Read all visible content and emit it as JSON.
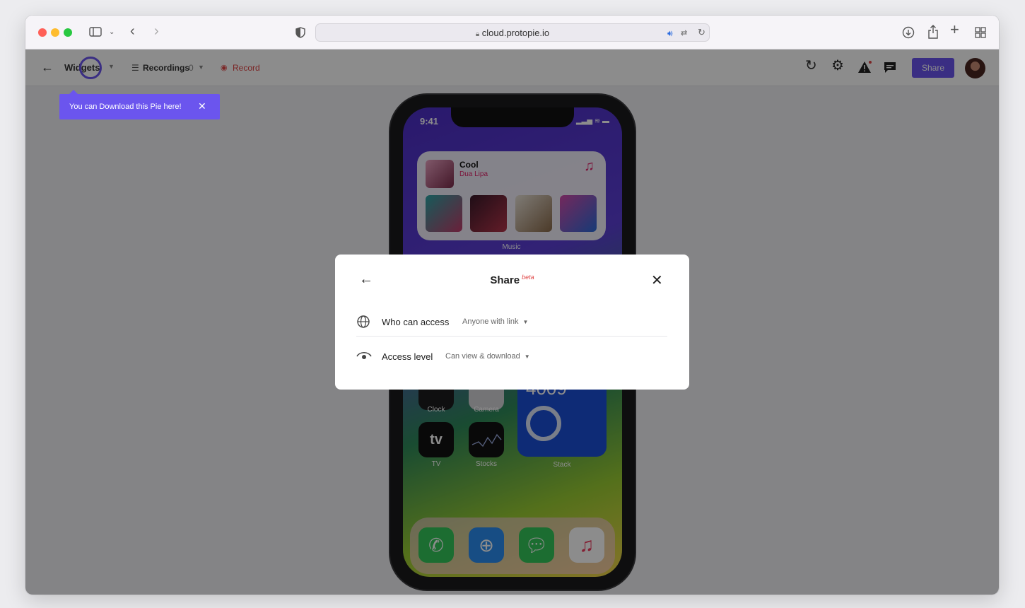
{
  "browser": {
    "url": "cloud.protopie.io"
  },
  "appbar": {
    "project_name": "Widgets",
    "recordings_label": "Recordings",
    "recordings_count": "0",
    "record_label": "Record",
    "share_label": "Share"
  },
  "tooltip": {
    "text": "You can Download this Pie here!"
  },
  "phone": {
    "time": "9:41",
    "song_title": "Cool",
    "artist": "Dua Lipa",
    "music_widget_label": "Music",
    "apps": [
      {
        "label": "Clock"
      },
      {
        "label": "Camera"
      },
      {
        "label": "TV"
      },
      {
        "label": "Stocks"
      },
      {
        "label": "Stack"
      }
    ],
    "stack_value": "4009"
  },
  "modal": {
    "title": "Share",
    "badge": "beta",
    "rows": [
      {
        "label": "Who can access",
        "value": "Anyone with link"
      },
      {
        "label": "Access level",
        "value": "Can view & download"
      }
    ]
  }
}
